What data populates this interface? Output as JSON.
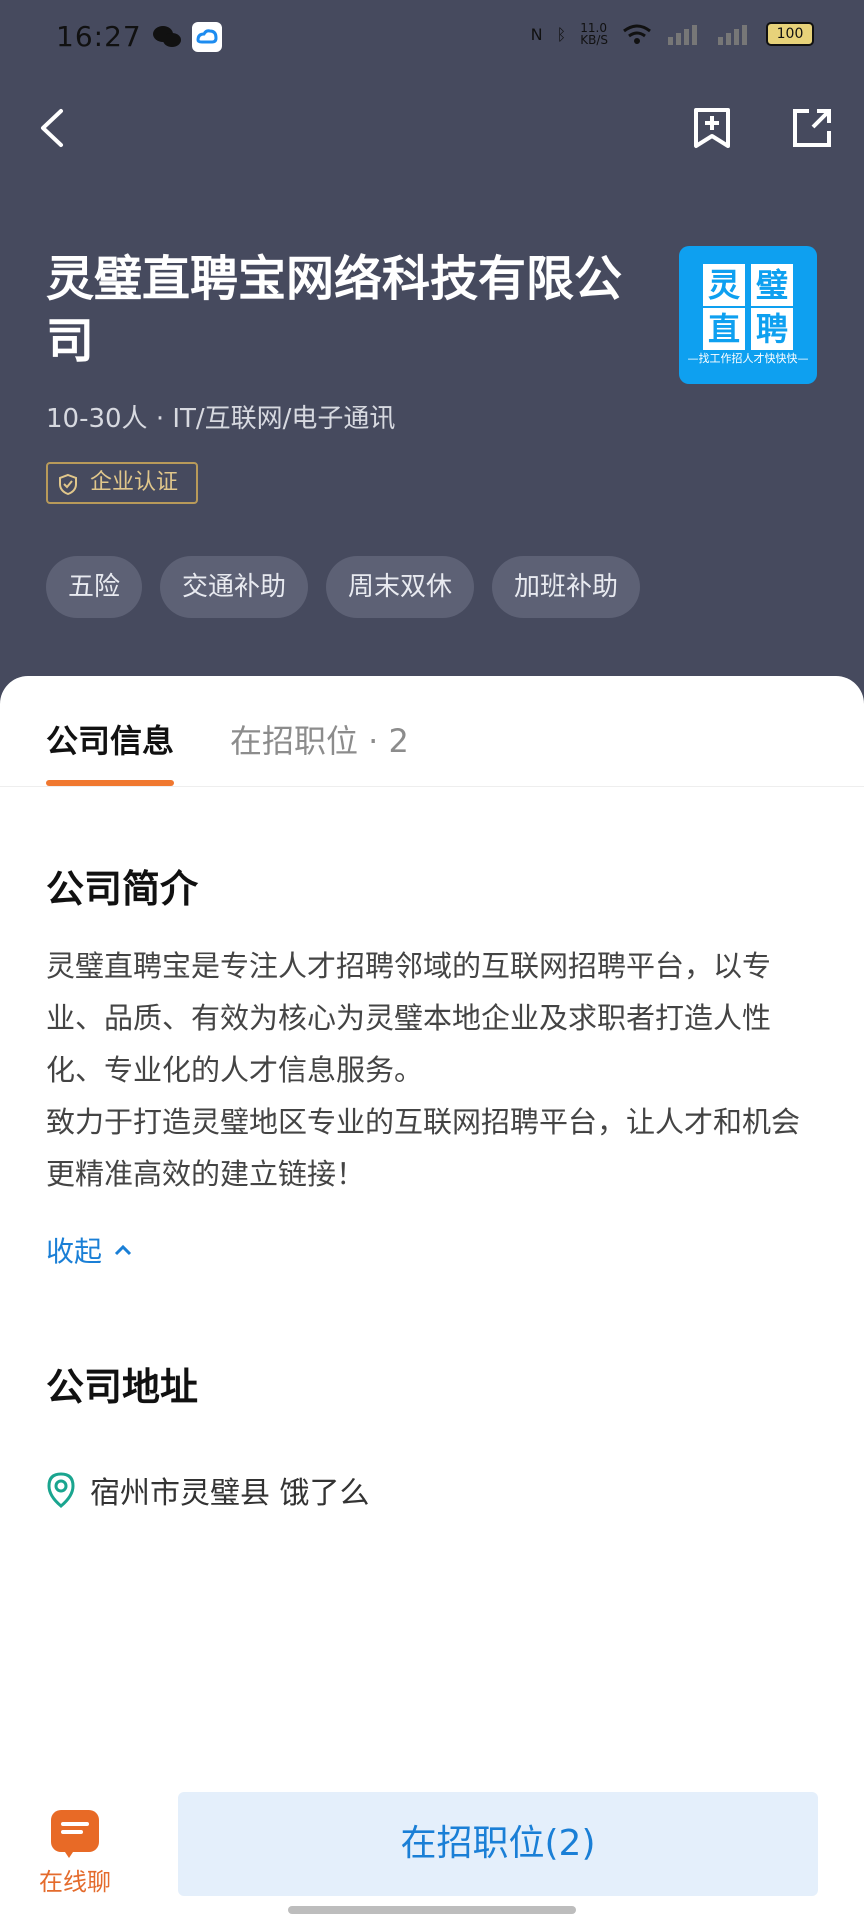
{
  "status_bar": {
    "time": "16:27",
    "network_speed": "11.0\nKB/S",
    "battery": "100"
  },
  "header": {
    "company_name": "灵璧直聘宝网络科技有限公司",
    "meta": "10-30人 · IT/互联网/电子通讯",
    "verify": "企业认证",
    "logo": {
      "g1": "灵",
      "g2": "璧",
      "g3": "直",
      "g4": "聘",
      "tagline": "—找工作招人才快快快—"
    },
    "tags": [
      "五险",
      "交通补助",
      "周末双休",
      "加班补助"
    ]
  },
  "tabs": {
    "company_info": "公司信息",
    "jobs": "在招职位 · 2"
  },
  "intro": {
    "title": "公司简介",
    "text": "灵璧直聘宝是专注人才招聘邻域的互联网招聘平台，以专业、品质、有效为核心为灵璧本地企业及求职者打造人性化、专业化的人才信息服务。\n致力于打造灵璧地区专业的互联网招聘平台，让人才和机会更精准高效的建立链接！",
    "collapse": "收起"
  },
  "address": {
    "title": "公司地址",
    "text": "宿州市灵璧县 饿了么"
  },
  "bottom": {
    "chat": "在线聊",
    "jobs_button": "在招职位(2)"
  },
  "colors": {
    "header_bg": "#464a5e",
    "accent_orange": "#f07830",
    "link_blue": "#1a7fd6",
    "logo_blue": "#0ea0f0"
  }
}
